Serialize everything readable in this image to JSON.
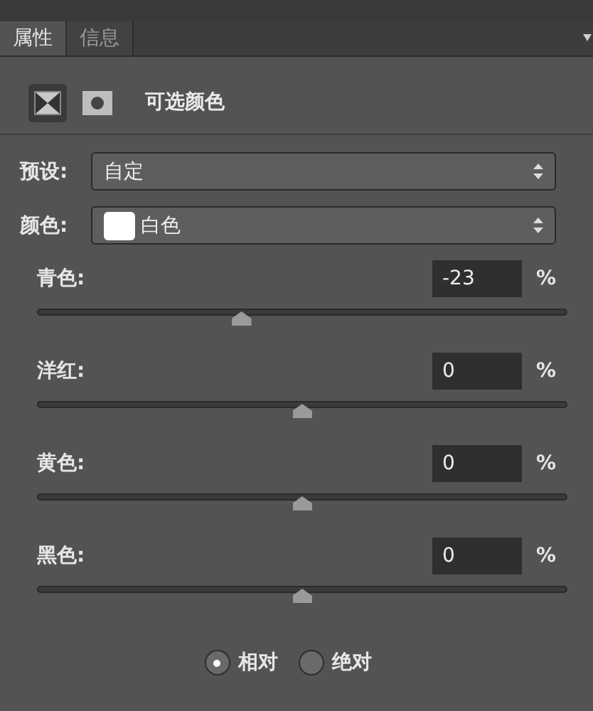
{
  "tabs": [
    {
      "label": "属性",
      "selected": true
    },
    {
      "label": "信息",
      "selected": false
    }
  ],
  "header": {
    "modes": [
      {
        "kind": "adjustment",
        "selected": true
      },
      {
        "kind": "mask",
        "selected": false
      }
    ],
    "title": "可选颜色"
  },
  "preset": {
    "label": "预设:",
    "value": "自定"
  },
  "colors": {
    "label": "颜色:",
    "value": "白色",
    "color": "#ffffff"
  },
  "channels": [
    {
      "name": "青色:",
      "value": "-23",
      "unit": "%",
      "level": 0.385
    },
    {
      "name": "洋红:",
      "value": "0",
      "unit": "%",
      "level": 0.5
    },
    {
      "name": "黄色:",
      "value": "0",
      "unit": "%",
      "level": 0.5
    },
    {
      "name": "黑色:",
      "value": "0",
      "unit": "%",
      "level": 0.5
    }
  ],
  "method": [
    {
      "label": "相对",
      "selected": true
    },
    {
      "label": "绝对",
      "selected": false
    }
  ]
}
